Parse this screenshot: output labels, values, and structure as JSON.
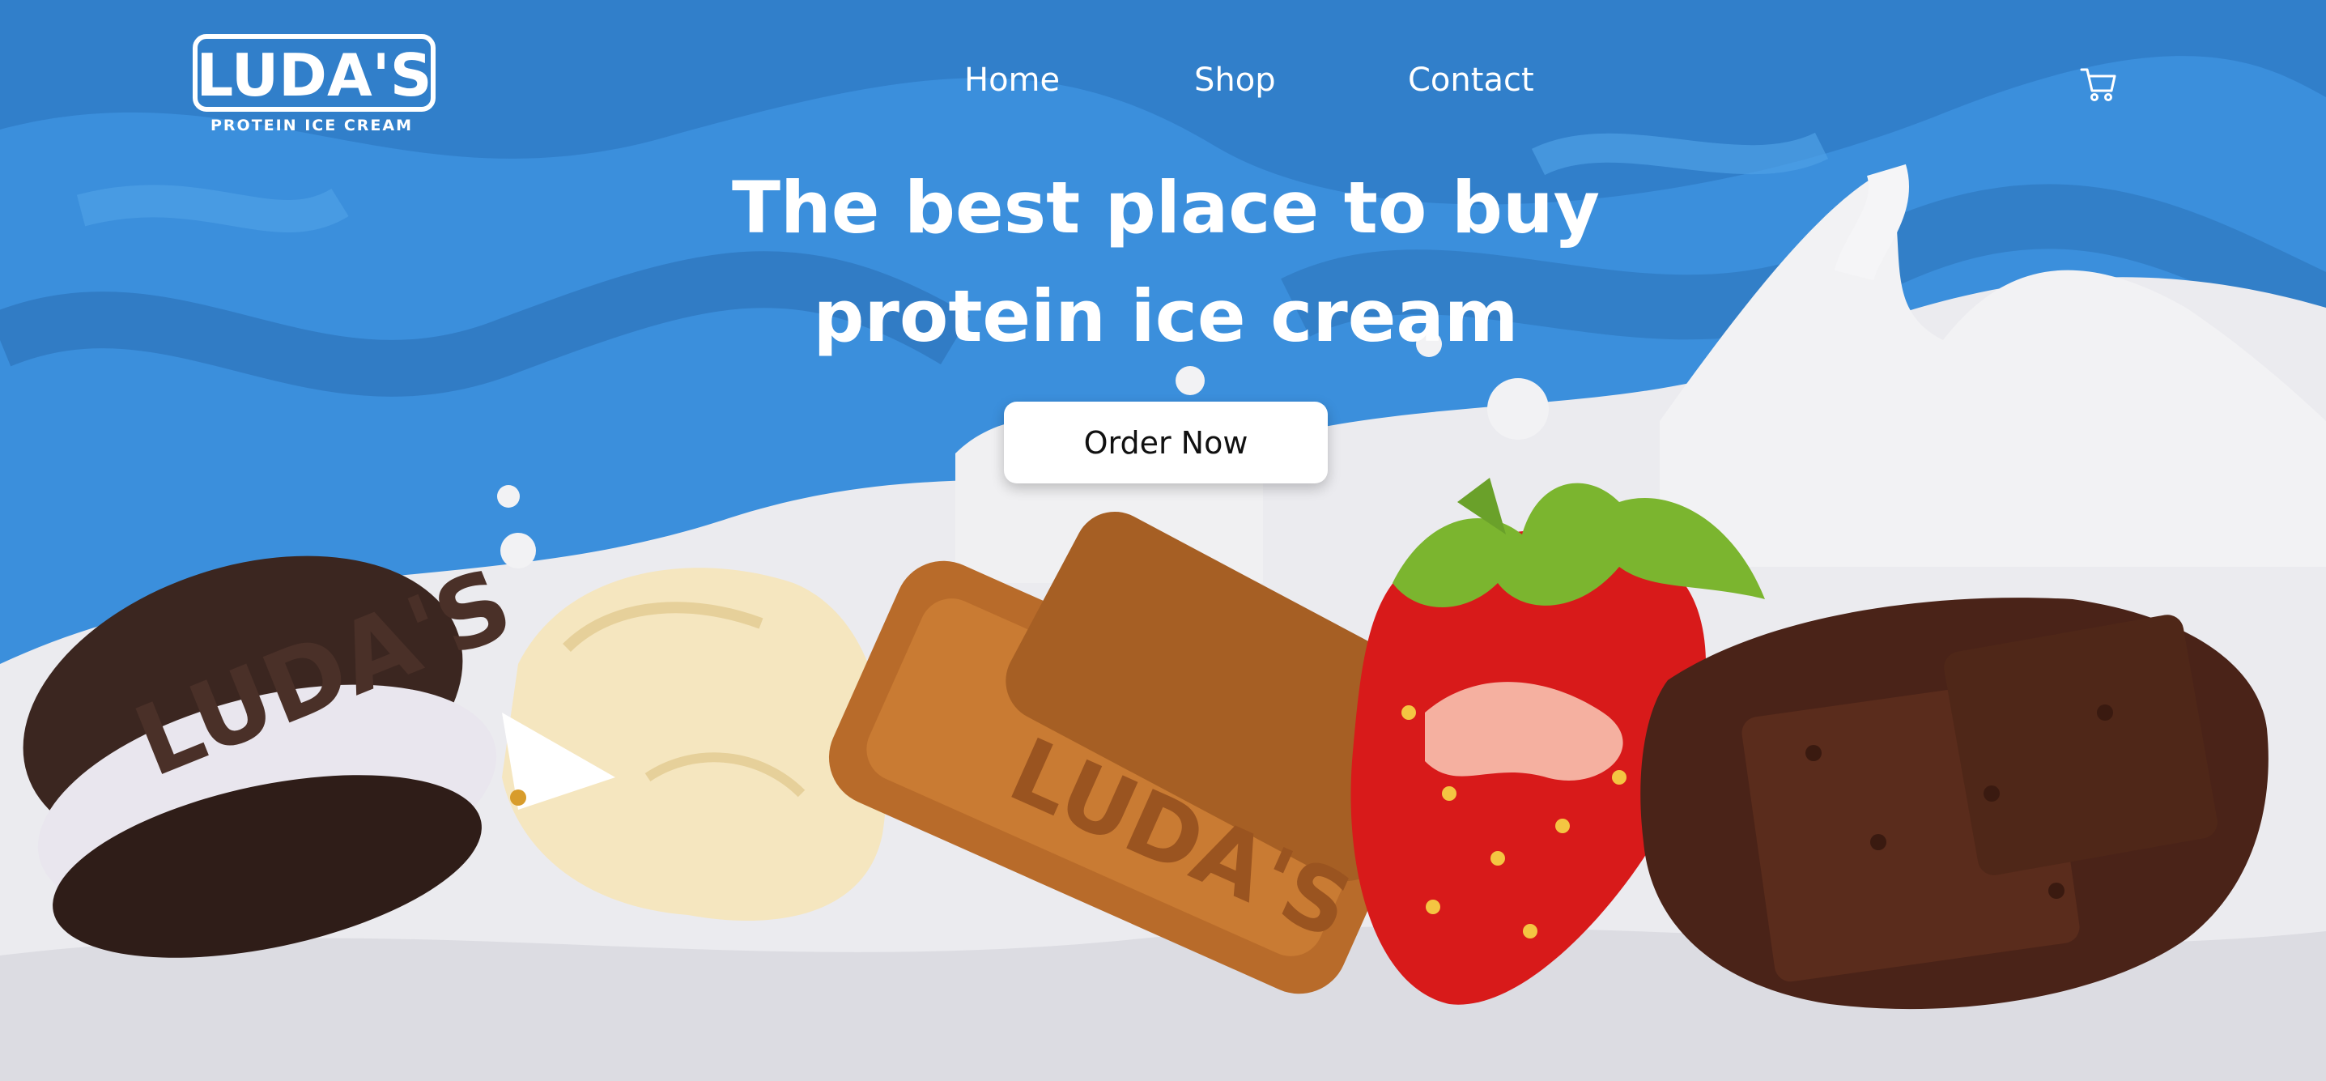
{
  "brand": {
    "logo_word": "LUDA'S",
    "tagline": "PROTEIN ICE CREAM"
  },
  "nav": {
    "items": [
      {
        "label": "Home"
      },
      {
        "label": "Shop"
      },
      {
        "label": "Contact"
      }
    ],
    "cart_icon": "shopping-cart-icon"
  },
  "hero": {
    "headline_line1": "The best place to buy",
    "headline_line2": "protein ice cream",
    "cta_label": "Order Now"
  },
  "flavors": [
    {
      "name": "cookies and cream sandwich",
      "imprint": "LUDA'S"
    },
    {
      "name": "vanilla scoop",
      "imprint": ""
    },
    {
      "name": "biscoff cookie",
      "imprint": "LUDA'S"
    },
    {
      "name": "strawberry",
      "imprint": ""
    },
    {
      "name": "chocolate brownie",
      "imprint": ""
    }
  ],
  "colors": {
    "background_blue": "#3b8fdc",
    "swirl_blue": "#2f7bc6",
    "milk": "#f0f0f2",
    "text": "#ffffff",
    "button": "#ffffff"
  }
}
